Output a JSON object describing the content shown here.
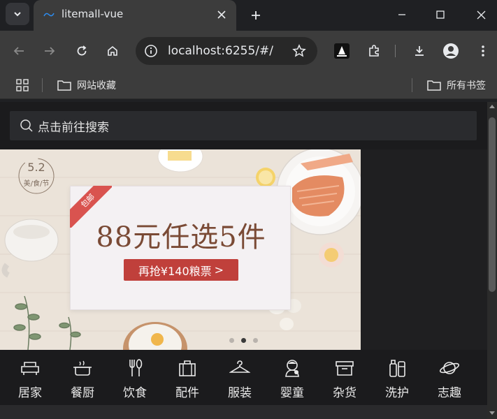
{
  "browser": {
    "tab_title": "litemall-vue",
    "url": "localhost:6255/#/",
    "bookmarks": {
      "left_label": "网站收藏",
      "right_label": "所有书签"
    }
  },
  "page": {
    "search_placeholder": "点击前往搜索",
    "banner": {
      "festival_number": "5.2",
      "festival_text": "美/食/节",
      "ribbon": "包邮",
      "headline": "88元任选5件",
      "cta": "再抢¥140粮票",
      "cta_arrow": ">",
      "dots": 3,
      "active_dot": 1
    },
    "nav_items": [
      {
        "label": "居家",
        "icon": "sofa-icon"
      },
      {
        "label": "餐厨",
        "icon": "pot-icon"
      },
      {
        "label": "饮食",
        "icon": "cutlery-icon"
      },
      {
        "label": "配件",
        "icon": "luggage-icon"
      },
      {
        "label": "服装",
        "icon": "hanger-icon"
      },
      {
        "label": "婴童",
        "icon": "baby-icon"
      },
      {
        "label": "杂货",
        "icon": "box-icon"
      },
      {
        "label": "洗护",
        "icon": "bottle-icon"
      },
      {
        "label": "志趣",
        "icon": "planet-icon"
      }
    ]
  },
  "colors": {
    "cta": "#c0403b",
    "headline": "#7a4a35"
  }
}
